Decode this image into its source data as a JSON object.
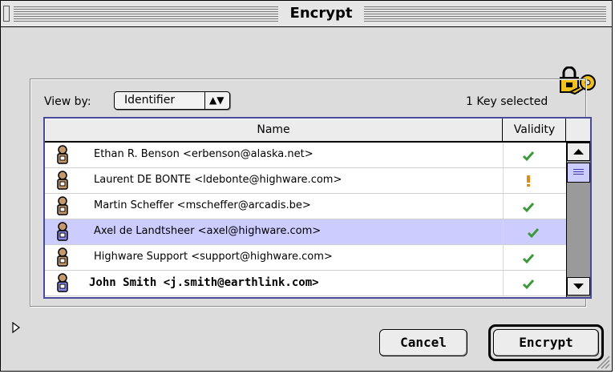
{
  "window": {
    "title": "Encrypt"
  },
  "toolbar": {
    "view_by_label": "View by:",
    "view_by_value": "Identifier",
    "selection_status": "1 Key selected"
  },
  "list": {
    "columns": [
      "Name",
      "Validity"
    ],
    "rows": [
      {
        "name": "Ethan R. Benson <erbenson@alaska.net>",
        "validity": "valid",
        "selected": false,
        "bold": false
      },
      {
        "name": "Laurent DE BONTE <ldebonte@highware.com>",
        "validity": "warning",
        "selected": false,
        "bold": false
      },
      {
        "name": "Martin Scheffer <mscheffer@arcadis.be>",
        "validity": "valid",
        "selected": false,
        "bold": false
      },
      {
        "name": "Axel de Landtsheer <axel@highware.com>",
        "validity": "valid",
        "selected": true,
        "bold": false
      },
      {
        "name": "Highware Support <support@highware.com>",
        "validity": "valid",
        "selected": false,
        "bold": false
      },
      {
        "name": "John Smith <j.smith@earthlink.com>",
        "validity": "valid",
        "selected": false,
        "bold": true
      }
    ]
  },
  "buttons": {
    "cancel": "Cancel",
    "encrypt": "Encrypt"
  },
  "icons": {
    "header": "lock-key-icon",
    "row": "person-key-icon",
    "valid": "checkmark-icon",
    "warning": "exclamation-icon"
  },
  "colors": {
    "selection": "#ccccff",
    "valid": "#3a9a3a",
    "warning": "#e08a1a",
    "list_border": "#4a4a9a"
  }
}
